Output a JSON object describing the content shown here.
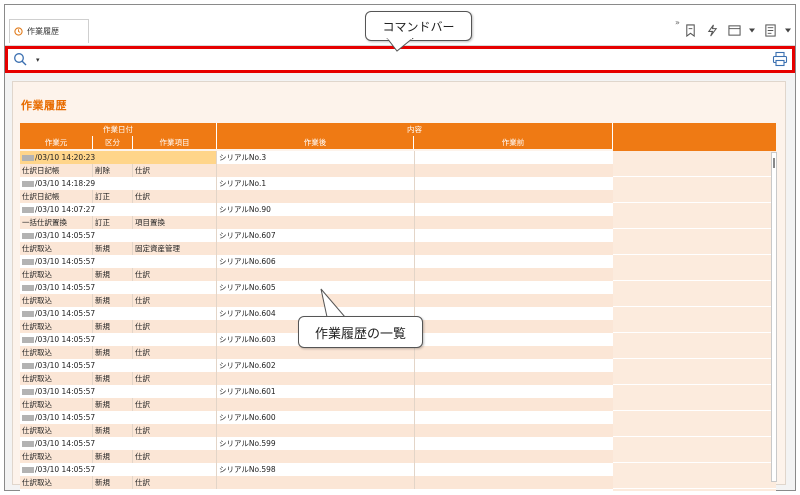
{
  "tab": {
    "label": "作業履歴"
  },
  "topbar": {
    "more": "»"
  },
  "icons": [
    "history-icon",
    "bookmark-icon",
    "lightning-icon",
    "window-icon",
    "dropdown-icon",
    "form-icon",
    "search-icon",
    "print-icon"
  ],
  "commandbar": {
    "caret": "▾"
  },
  "page": {
    "title": "作業履歴"
  },
  "headers": {
    "group_date": "作業日付",
    "group_content": "内容",
    "col_source": "作業元",
    "col_kind": "区分",
    "col_item": "作業項目",
    "col_after": "作業後",
    "col_before": "作業前"
  },
  "records": [
    {
      "date": "/03/10 14:20:23",
      "after": "シリアルNo.3",
      "before": "",
      "source": "仕訳日記帳",
      "kind": "削除",
      "item": "仕訳"
    },
    {
      "date": "/03/10 14:18:29",
      "after": "シリアルNo.1",
      "before": "",
      "source": "仕訳日記帳",
      "kind": "訂正",
      "item": "仕訳"
    },
    {
      "date": "/03/10 14:07:27",
      "after": "シリアルNo.90",
      "before": "",
      "source": "一括仕訳置換",
      "kind": "訂正",
      "item": "項目置換"
    },
    {
      "date": "/03/10 14:05:57",
      "after": "シリアルNo.607",
      "before": "",
      "source": "仕訳取込",
      "kind": "新規",
      "item": "固定資産管理"
    },
    {
      "date": "/03/10 14:05:57",
      "after": "シリアルNo.606",
      "before": "",
      "source": "仕訳取込",
      "kind": "新規",
      "item": "仕訳"
    },
    {
      "date": "/03/10 14:05:57",
      "after": "シリアルNo.605",
      "before": "",
      "source": "仕訳取込",
      "kind": "新規",
      "item": "仕訳"
    },
    {
      "date": "/03/10 14:05:57",
      "after": "シリアルNo.604",
      "before": "",
      "source": "仕訳取込",
      "kind": "新規",
      "item": "仕訳"
    },
    {
      "date": "/03/10 14:05:57",
      "after": "シリアルNo.603",
      "before": "",
      "source": "仕訳取込",
      "kind": "新規",
      "item": "仕訳"
    },
    {
      "date": "/03/10 14:05:57",
      "after": "シリアルNo.602",
      "before": "",
      "source": "仕訳取込",
      "kind": "新規",
      "item": "仕訳"
    },
    {
      "date": "/03/10 14:05:57",
      "after": "シリアルNo.601",
      "before": "",
      "source": "仕訳取込",
      "kind": "新規",
      "item": "仕訳"
    },
    {
      "date": "/03/10 14:05:57",
      "after": "シリアルNo.600",
      "before": "",
      "source": "仕訳取込",
      "kind": "新規",
      "item": "仕訳"
    },
    {
      "date": "/03/10 14:05:57",
      "after": "シリアルNo.599",
      "before": "",
      "source": "仕訳取込",
      "kind": "新規",
      "item": "仕訳"
    },
    {
      "date": "/03/10 14:05:57",
      "after": "シリアルNo.598",
      "before": "",
      "source": "仕訳取込",
      "kind": "新規",
      "item": "仕訳"
    }
  ],
  "callouts": {
    "commandbar": "コマンドバー",
    "history_list": "作業履歴の一覧"
  },
  "colors": {
    "accent": "#ef7a14",
    "highlight": "#e60000",
    "title": "#e86c00"
  }
}
